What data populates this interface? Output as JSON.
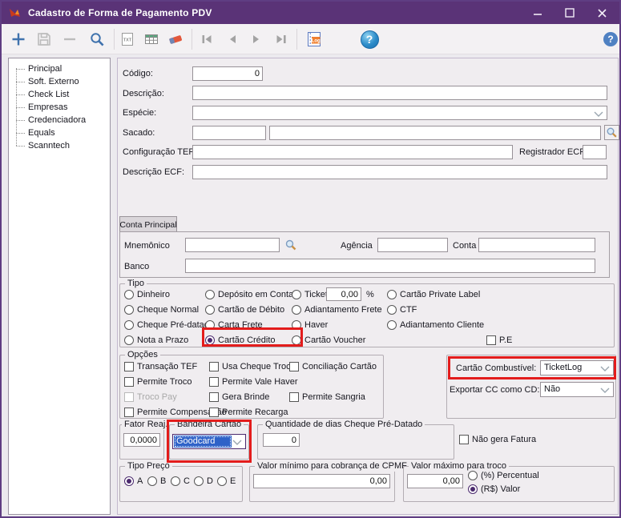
{
  "colors": {
    "titlebar_purple": "#5a3377",
    "annotation_red": "#e31c1c",
    "selection_blue": "#2e62c8",
    "radio_accent_purple": "#4b2a6e",
    "toolbar_icon_blue": "#3f72ad"
  },
  "window": {
    "title": "Cadastro de Forma de Pagamento PDV",
    "controls": [
      "minimize",
      "maximize",
      "close"
    ]
  },
  "toolbar": {
    "icons": [
      "add",
      "save",
      "remove",
      "search",
      "export-txt",
      "table",
      "eraser",
      "nav-first",
      "nav-prev",
      "nav-next",
      "nav-last",
      "log",
      "help",
      "help-secondary"
    ]
  },
  "sidebar": {
    "items": [
      "Principal",
      "Soft. Externo",
      "Check List",
      "Empresas",
      "Credenciadora",
      "Equals",
      "Scanntech"
    ]
  },
  "form": {
    "codigo_label": "Código:",
    "codigo_value": "0",
    "descricao_label": "Descrição:",
    "descricao_value": "",
    "especie_label": "Espécie:",
    "especie_value": "",
    "sacado_label": "Sacado:",
    "sacado_code": "",
    "sacado_name": "",
    "config_tef_label": "Configuração TEF:",
    "config_tef_value": "",
    "registrador_ecf_label": "Registrador ECF",
    "registrador_ecf_value": "",
    "descricao_ecf_label": "Descrição ECF:",
    "descricao_ecf_value": ""
  },
  "conta": {
    "tab_label": "Conta Principal",
    "mnemonico_label": "Mnemônico",
    "mnemonico_value": "",
    "agencia_label": "Agência",
    "agencia_value": "",
    "conta_label": "Conta",
    "conta_value": "",
    "banco_label": "Banco",
    "banco_value": ""
  },
  "tipo": {
    "title": "Tipo",
    "col1": [
      "Dinheiro",
      "Cheque Normal",
      "Cheque Pré-datado",
      "Nota a Prazo"
    ],
    "col2": [
      "Depósito em Conta",
      "Cartão de Débito",
      "Carta Frete",
      "Cartão Crédito"
    ],
    "col3": [
      "Ticket",
      "Adiantamento Frete",
      "Haver",
      "Cartão Voucher"
    ],
    "col4": [
      "Cartão Private Label",
      "CTF",
      "Adiantamento Cliente"
    ],
    "selected": "Cartão Crédito",
    "ticket_value": "0,00",
    "percent_label": "%",
    "pe_label": "P.E"
  },
  "opcoes": {
    "title": "Opções",
    "col1": [
      "Transação TEF",
      "Permite Troco",
      "Troco Pay",
      "Permite Compensação"
    ],
    "col2": [
      "Usa Cheque Troco",
      "Permite Vale Haver",
      "Gera Brinde",
      "Permite Recarga"
    ],
    "col3": [
      "Conciliação Cartão",
      "Permite Sangria"
    ],
    "disabled_item": "Troco Pay"
  },
  "combustivel": {
    "label": "Cartão Combustível:",
    "value": "TicketLog"
  },
  "exportar_cc": {
    "label": "Exportar CC como CD:",
    "value": "Não"
  },
  "fator": {
    "title": "Fator Reaj.",
    "value": "0,0000"
  },
  "bandeira": {
    "title": "Bandeira Cartão",
    "value": "Goodcard"
  },
  "qtd_dias": {
    "title": "Quantidade de dias Cheque Pré-Datado",
    "value": "0"
  },
  "nao_gera_fatura_label": "Não gera Fatura",
  "tipo_preco": {
    "title": "Tipo Preço",
    "options": [
      "A",
      "B",
      "C",
      "D",
      "E"
    ],
    "selected": "A"
  },
  "valor_minimo": {
    "title": "Valor mínimo para cobrança de CPMF",
    "value": "0,00"
  },
  "valor_maximo": {
    "title": "Valor máximo para troco",
    "value": "0,00",
    "percent_option": "(%) Percentual",
    "valor_option": "(R$) Valor",
    "selected": "(R$) Valor"
  }
}
